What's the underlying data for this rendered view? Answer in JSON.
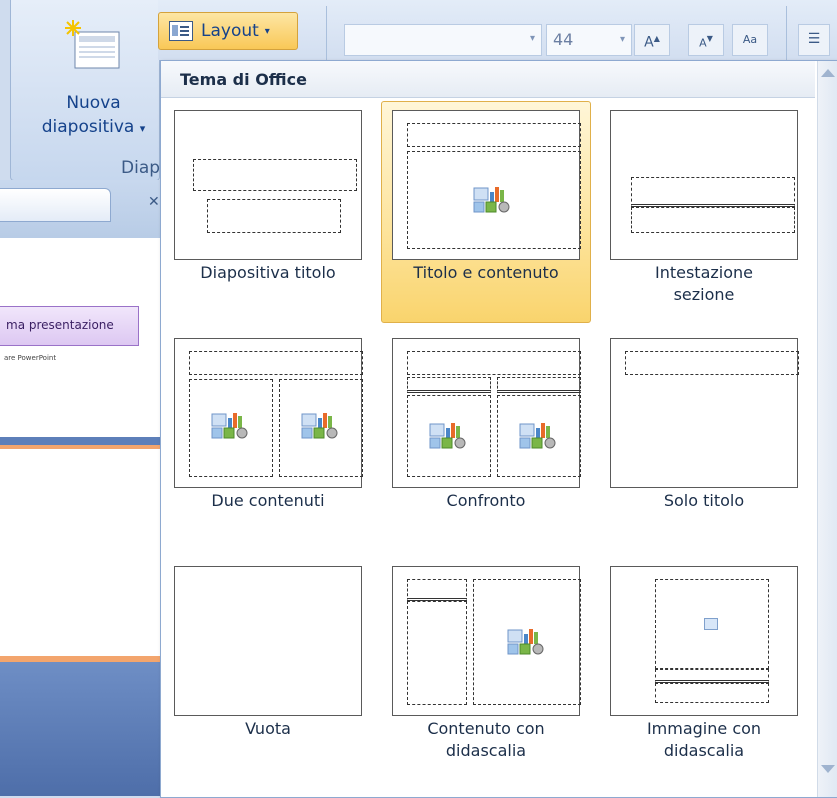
{
  "ribbon": {
    "new_slide_line1": "Nuova",
    "new_slide_line2": "diapositiva",
    "new_slide_chev": "▾",
    "group_label": "Diap",
    "slide_pane_label": "ma presentazione",
    "slide_pane_sub": "are PowerPoint"
  },
  "toolbar": {
    "layout_label": "Layout",
    "layout_chev": "▾",
    "font_size": "44",
    "grow_font": "A",
    "shrink_font": "A",
    "clear_format": "Aa"
  },
  "gallery": {
    "header": "Tema di Office",
    "selected_index": 1,
    "items": [
      {
        "caption_line1": "Diapositiva titolo",
        "caption_line2": ""
      },
      {
        "caption_line1": "Titolo e contenuto",
        "caption_line2": ""
      },
      {
        "caption_line1": "Intestazione",
        "caption_line2": "sezione"
      },
      {
        "caption_line1": "Due contenuti",
        "caption_line2": ""
      },
      {
        "caption_line1": "Confronto",
        "caption_line2": ""
      },
      {
        "caption_line1": "Solo titolo",
        "caption_line2": ""
      },
      {
        "caption_line1": "Vuota",
        "caption_line2": ""
      },
      {
        "caption_line1": "Contenuto con",
        "caption_line2": "didascalia"
      },
      {
        "caption_line1": "Immagine con",
        "caption_line2": "didascalia"
      }
    ]
  },
  "colors": {
    "selected_bg": "#fde39a",
    "selected_border": "#e0b04a",
    "header_text": "#1c2f4a",
    "ribbon_text": "#15428b"
  }
}
